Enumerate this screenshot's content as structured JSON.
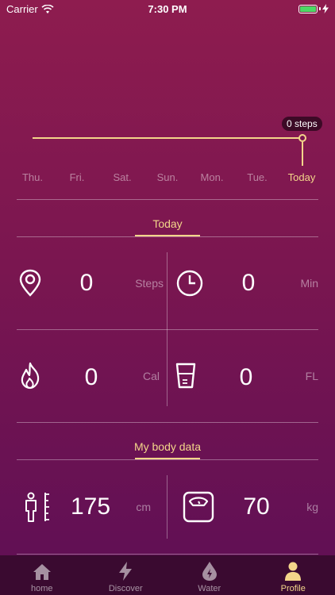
{
  "status": {
    "carrier": "Carrier",
    "time": "7:30 PM"
  },
  "chart_badge": "0 steps",
  "days": [
    "Thu.",
    "Fri.",
    "Sat.",
    "Sun.",
    "Mon.",
    "Tue.",
    "Today"
  ],
  "sections": {
    "today": "Today",
    "body": "My body data"
  },
  "stats": {
    "steps": {
      "value": "0",
      "unit": "Steps"
    },
    "minutes": {
      "value": "0",
      "unit": "Min"
    },
    "calories": {
      "value": "0",
      "unit": "Cal"
    },
    "water": {
      "value": "0",
      "unit": "FL"
    },
    "height": {
      "value": "175",
      "unit": "cm"
    },
    "weight": {
      "value": "70",
      "unit": "kg"
    }
  },
  "tabs": [
    {
      "label": "home",
      "icon": "home-icon"
    },
    {
      "label": "Discover",
      "icon": "lightning-icon"
    },
    {
      "label": "Water",
      "icon": "water-drop-icon"
    },
    {
      "label": "Profile",
      "icon": "person-icon"
    }
  ],
  "colors": {
    "accent": "#f3d58a",
    "battery": "#4cd964"
  }
}
